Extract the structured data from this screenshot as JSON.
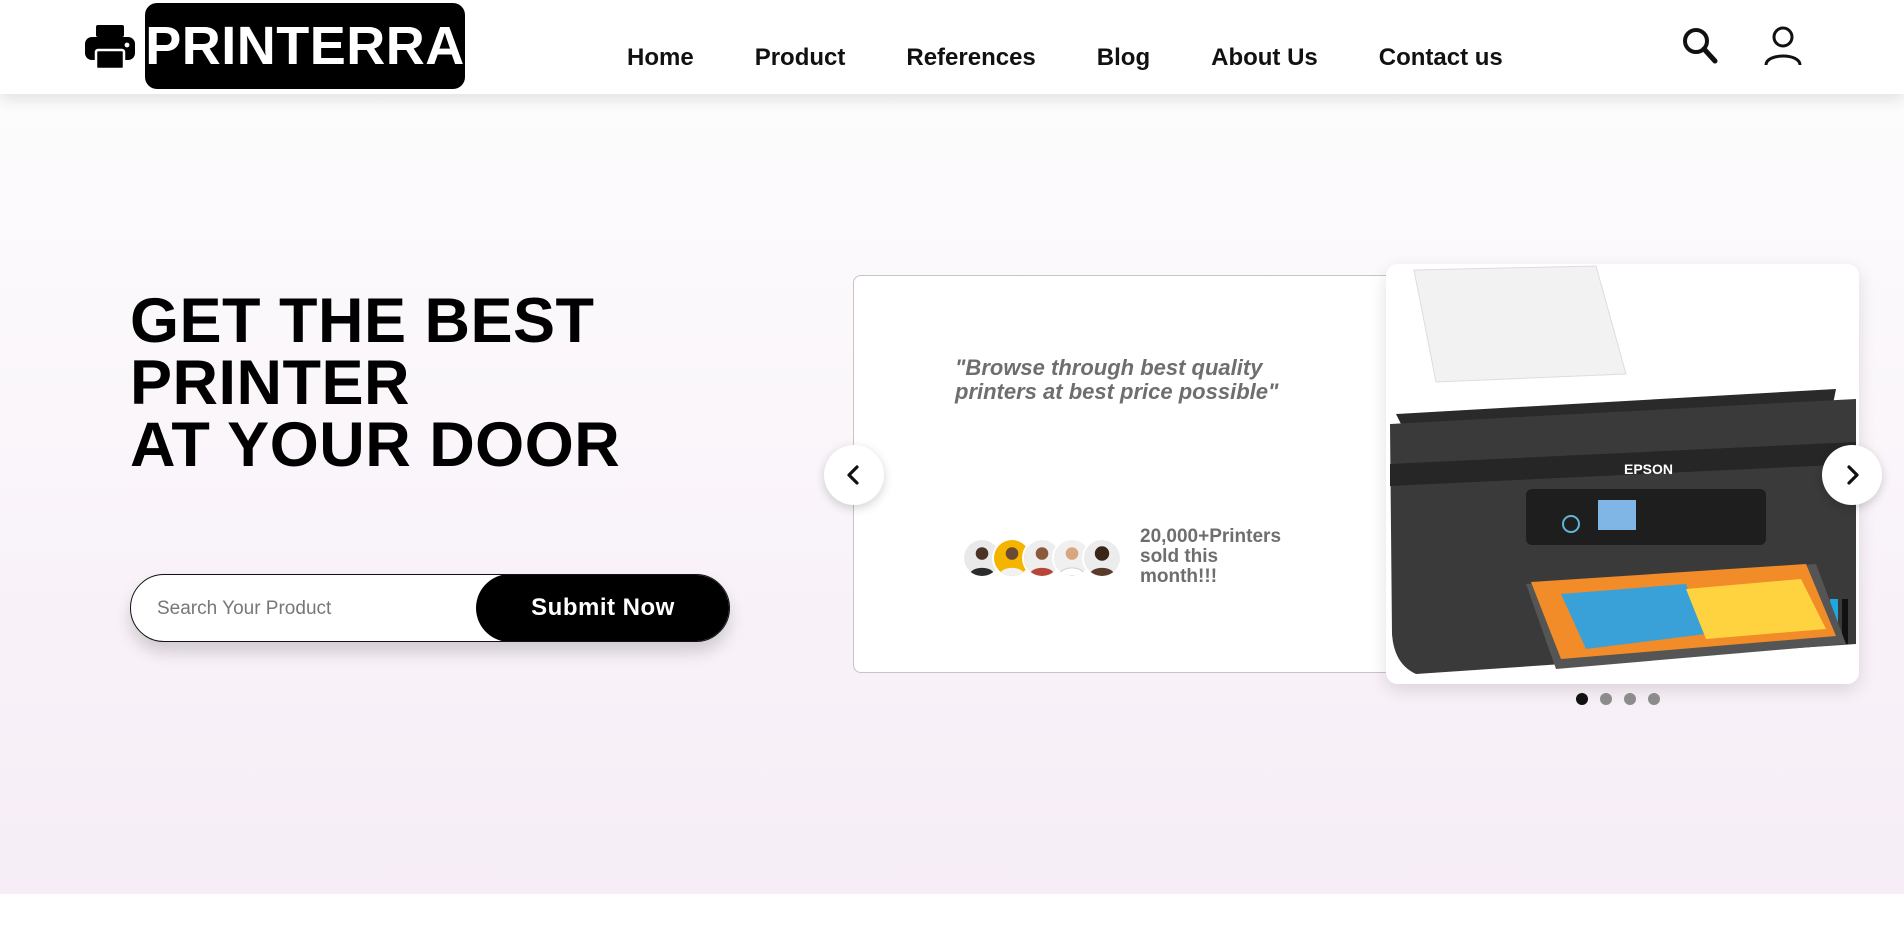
{
  "header": {
    "logo_text": "PRINTERRA",
    "logo_icon": "printer-icon",
    "nav": [
      {
        "label": "Home"
      },
      {
        "label": "Product"
      },
      {
        "label": "References"
      },
      {
        "label": "Blog"
      },
      {
        "label": "About Us"
      },
      {
        "label": "Contact us"
      }
    ],
    "search_icon": "search-icon",
    "user_icon": "user-icon"
  },
  "hero": {
    "headline_lines": [
      "GET THE BEST",
      "PRINTER",
      "AT YOUR DOOR"
    ],
    "search": {
      "placeholder": "Search Your Product",
      "value": ""
    },
    "submit_label": "Submit Now"
  },
  "carousel": {
    "quote": "\"Browse through best quality printers at best price possible\"",
    "sold_text": "20,000+Printers sold this month!!!",
    "product_brand": "EPSON",
    "prev_icon": "chevron-left-icon",
    "next_icon": "chevron-right-icon",
    "slides_total": 4,
    "active_slide": 1
  },
  "colors": {
    "brand": "#000000",
    "hero_bg_top": "#fdfcfd",
    "hero_bg_bottom": "#f6edf6",
    "muted_text": "#6e6e6e"
  }
}
